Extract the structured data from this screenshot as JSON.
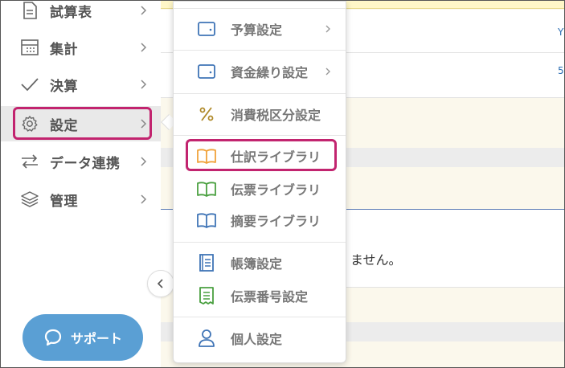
{
  "sidebar": {
    "items": [
      {
        "label": "試算表",
        "icon": "document-icon"
      },
      {
        "label": "集計",
        "icon": "calculator-icon"
      },
      {
        "label": "決算",
        "icon": "check-icon"
      },
      {
        "label": "設定",
        "icon": "gear-icon",
        "active": true
      },
      {
        "label": "データ連携",
        "icon": "sync-arrows-icon"
      },
      {
        "label": "管理",
        "icon": "layers-icon"
      }
    ],
    "support_label": "サポート"
  },
  "menu": {
    "items": [
      {
        "label": "予算設定",
        "icon": "wallet-icon",
        "has_submenu": true
      },
      {
        "label": "資金繰り設定",
        "icon": "wallet-icon",
        "has_submenu": true
      },
      {
        "label": "消費税区分設定",
        "icon": "percent-icon"
      },
      {
        "label": "仕訳ライブラリ",
        "icon": "book-icon",
        "highlighted": true
      },
      {
        "label": "伝票ライブラリ",
        "icon": "book-icon"
      },
      {
        "label": "摘要ライブラリ",
        "icon": "book-icon"
      },
      {
        "label": "帳簿設定",
        "icon": "ledger-icon"
      },
      {
        "label": "伝票番号設定",
        "icon": "receipt-icon"
      },
      {
        "label": "個人設定",
        "icon": "person-icon"
      }
    ]
  },
  "main": {
    "message_fragment": "ません。",
    "edge_chars": [
      "Y",
      "5"
    ]
  },
  "colors": {
    "highlight": "#c2246f",
    "support_bg": "#5a9fd4",
    "icon_blue": "#3f74b6",
    "icon_orange": "#f0a23a",
    "icon_green": "#4aa040",
    "icon_gold": "#b08a2a"
  }
}
